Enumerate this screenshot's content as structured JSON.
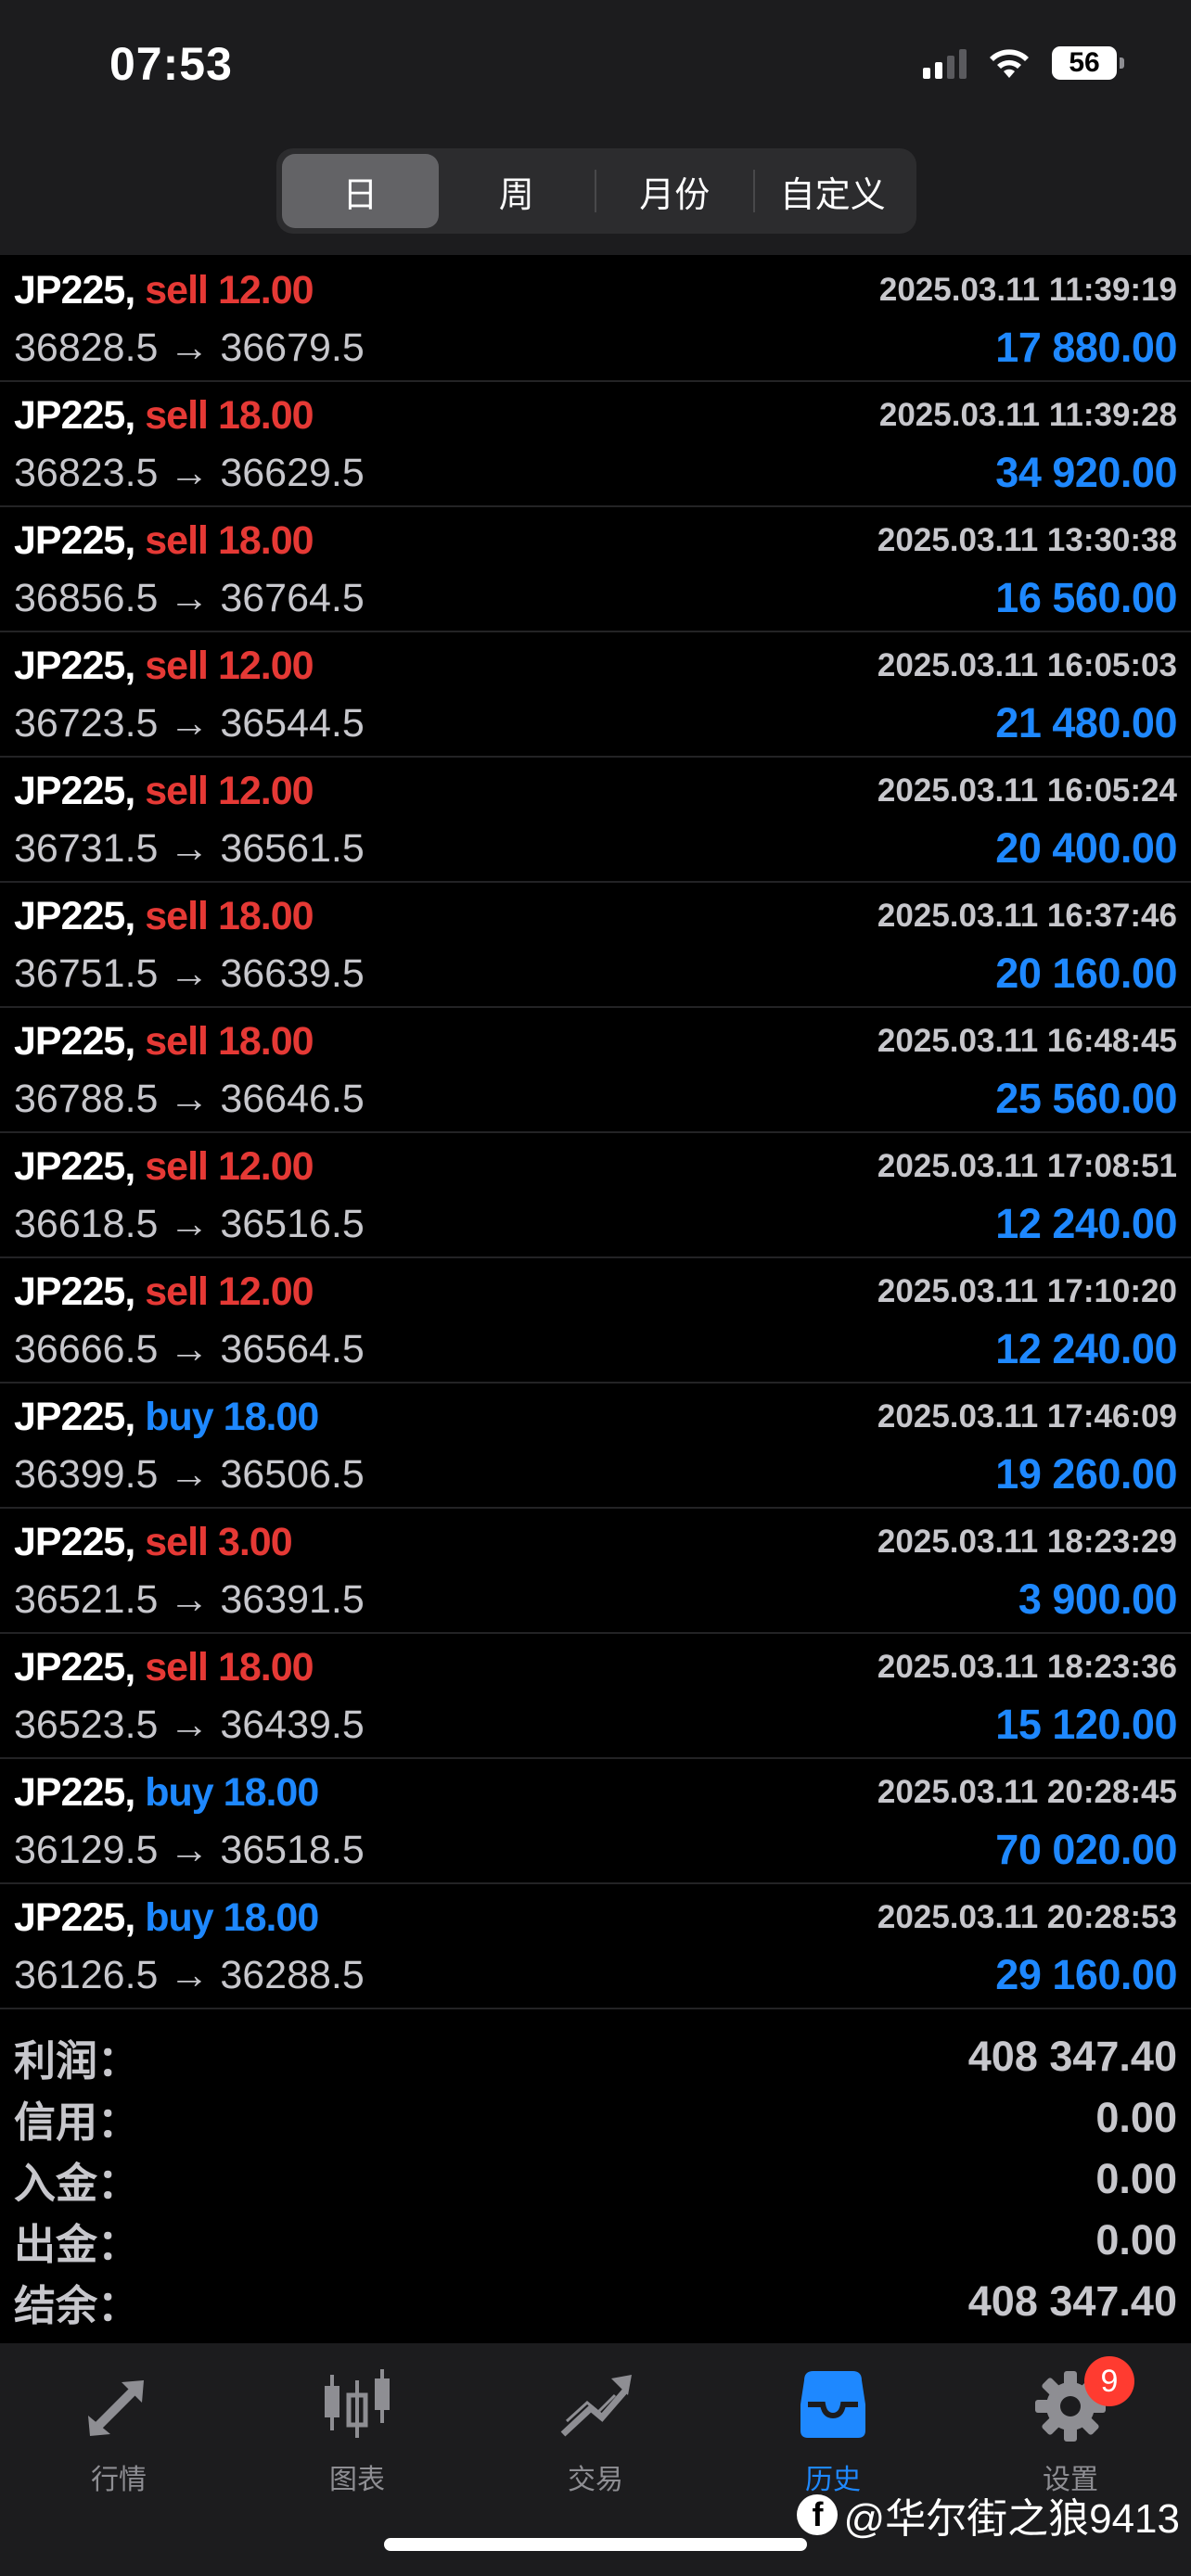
{
  "status_bar": {
    "time": "07:53",
    "battery": "56"
  },
  "period_tabs": [
    {
      "label": "日",
      "active": true
    },
    {
      "label": "周",
      "active": false
    },
    {
      "label": "月份",
      "active": false
    },
    {
      "label": "自定义",
      "active": false
    }
  ],
  "deals": [
    {
      "symbol": "JP225,",
      "side": "sell",
      "volume": "12.00",
      "datetime": "2025.03.11 11:39:19",
      "prices": "36828.5 → 36679.5",
      "profit": "17 880.00"
    },
    {
      "symbol": "JP225,",
      "side": "sell",
      "volume": "18.00",
      "datetime": "2025.03.11 11:39:28",
      "prices": "36823.5 → 36629.5",
      "profit": "34 920.00"
    },
    {
      "symbol": "JP225,",
      "side": "sell",
      "volume": "18.00",
      "datetime": "2025.03.11 13:30:38",
      "prices": "36856.5 → 36764.5",
      "profit": "16 560.00"
    },
    {
      "symbol": "JP225,",
      "side": "sell",
      "volume": "12.00",
      "datetime": "2025.03.11 16:05:03",
      "prices": "36723.5 → 36544.5",
      "profit": "21 480.00"
    },
    {
      "symbol": "JP225,",
      "side": "sell",
      "volume": "12.00",
      "datetime": "2025.03.11 16:05:24",
      "prices": "36731.5 → 36561.5",
      "profit": "20 400.00"
    },
    {
      "symbol": "JP225,",
      "side": "sell",
      "volume": "18.00",
      "datetime": "2025.03.11 16:37:46",
      "prices": "36751.5 → 36639.5",
      "profit": "20 160.00"
    },
    {
      "symbol": "JP225,",
      "side": "sell",
      "volume": "18.00",
      "datetime": "2025.03.11 16:48:45",
      "prices": "36788.5 → 36646.5",
      "profit": "25 560.00"
    },
    {
      "symbol": "JP225,",
      "side": "sell",
      "volume": "12.00",
      "datetime": "2025.03.11 17:08:51",
      "prices": "36618.5 → 36516.5",
      "profit": "12 240.00"
    },
    {
      "symbol": "JP225,",
      "side": "sell",
      "volume": "12.00",
      "datetime": "2025.03.11 17:10:20",
      "prices": "36666.5 → 36564.5",
      "profit": "12 240.00"
    },
    {
      "symbol": "JP225,",
      "side": "buy",
      "volume": "18.00",
      "datetime": "2025.03.11 17:46:09",
      "prices": "36399.5 → 36506.5",
      "profit": "19 260.00"
    },
    {
      "symbol": "JP225,",
      "side": "sell",
      "volume": "3.00",
      "datetime": "2025.03.11 18:23:29",
      "prices": "36521.5 → 36391.5",
      "profit": "3 900.00"
    },
    {
      "symbol": "JP225,",
      "side": "sell",
      "volume": "18.00",
      "datetime": "2025.03.11 18:23:36",
      "prices": "36523.5 → 36439.5",
      "profit": "15 120.00"
    },
    {
      "symbol": "JP225,",
      "side": "buy",
      "volume": "18.00",
      "datetime": "2025.03.11 20:28:45",
      "prices": "36129.5 → 36518.5",
      "profit": "70 020.00"
    },
    {
      "symbol": "JP225,",
      "side": "buy",
      "volume": "18.00",
      "datetime": "2025.03.11 20:28:53",
      "prices": "36126.5 → 36288.5",
      "profit": "29 160.00"
    }
  ],
  "summary": [
    {
      "label": "利润：",
      "value": "408 347.40"
    },
    {
      "label": "信用：",
      "value": "0.00"
    },
    {
      "label": "入金：",
      "value": "0.00"
    },
    {
      "label": "出金：",
      "value": "0.00"
    },
    {
      "label": "结余：",
      "value": "408 347.40"
    }
  ],
  "tabbar": [
    {
      "label": "行情",
      "icon": "quotes-arrows-icon",
      "active": false
    },
    {
      "label": "图表",
      "icon": "candlestick-chart-icon",
      "active": false
    },
    {
      "label": "交易",
      "icon": "trade-trend-icon",
      "active": false
    },
    {
      "label": "历史",
      "icon": "history-inbox-icon",
      "active": true
    },
    {
      "label": "设置",
      "icon": "gear-icon",
      "active": false,
      "badge": "9"
    }
  ],
  "watermark": {
    "text": "@华尔街之狼9413",
    "icon": "facebook-icon"
  },
  "colors": {
    "sell": "#e53935",
    "buy": "#1e88ff",
    "profit": "#1e88ff",
    "active_tab": "#1e88ff"
  }
}
